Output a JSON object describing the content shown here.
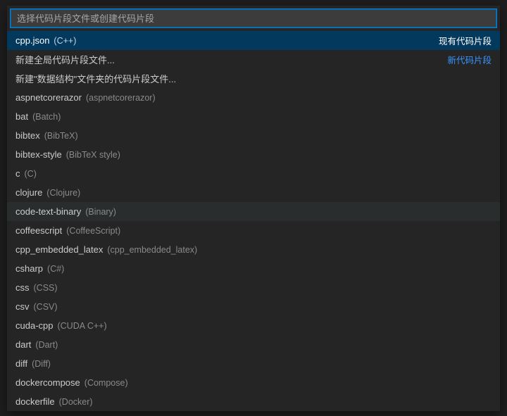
{
  "picker": {
    "placeholder": "选择代码片段文件或创建代码片段",
    "value": "",
    "items": [
      {
        "label": "cpp.json",
        "detail": "(C++)",
        "right": "现有代码片段",
        "rightClass": "gray",
        "selected": true
      },
      {
        "label": "新建全局代码片段文件...",
        "detail": "",
        "right": "新代码片段",
        "rightClass": "blue"
      },
      {
        "label": "新建\"数据结构\"文件夹的代码片段文件...",
        "detail": "",
        "right": ""
      },
      {
        "label": "aspnetcorerazor",
        "detail": "(aspnetcorerazor)",
        "right": ""
      },
      {
        "label": "bat",
        "detail": "(Batch)",
        "right": ""
      },
      {
        "label": "bibtex",
        "detail": "(BibTeX)",
        "right": ""
      },
      {
        "label": "bibtex-style",
        "detail": "(BibTeX style)",
        "right": ""
      },
      {
        "label": "c",
        "detail": "(C)",
        "right": ""
      },
      {
        "label": "clojure",
        "detail": "(Clojure)",
        "right": ""
      },
      {
        "label": "code-text-binary",
        "detail": "(Binary)",
        "right": "",
        "hover": true
      },
      {
        "label": "coffeescript",
        "detail": "(CoffeeScript)",
        "right": ""
      },
      {
        "label": "cpp_embedded_latex",
        "detail": "(cpp_embedded_latex)",
        "right": ""
      },
      {
        "label": "csharp",
        "detail": "(C#)",
        "right": ""
      },
      {
        "label": "css",
        "detail": "(CSS)",
        "right": ""
      },
      {
        "label": "csv",
        "detail": "(CSV)",
        "right": ""
      },
      {
        "label": "cuda-cpp",
        "detail": "(CUDA C++)",
        "right": ""
      },
      {
        "label": "dart",
        "detail": "(Dart)",
        "right": ""
      },
      {
        "label": "diff",
        "detail": "(Diff)",
        "right": ""
      },
      {
        "label": "dockercompose",
        "detail": "(Compose)",
        "right": ""
      },
      {
        "label": "dockerfile",
        "detail": "(Docker)",
        "right": ""
      }
    ]
  }
}
